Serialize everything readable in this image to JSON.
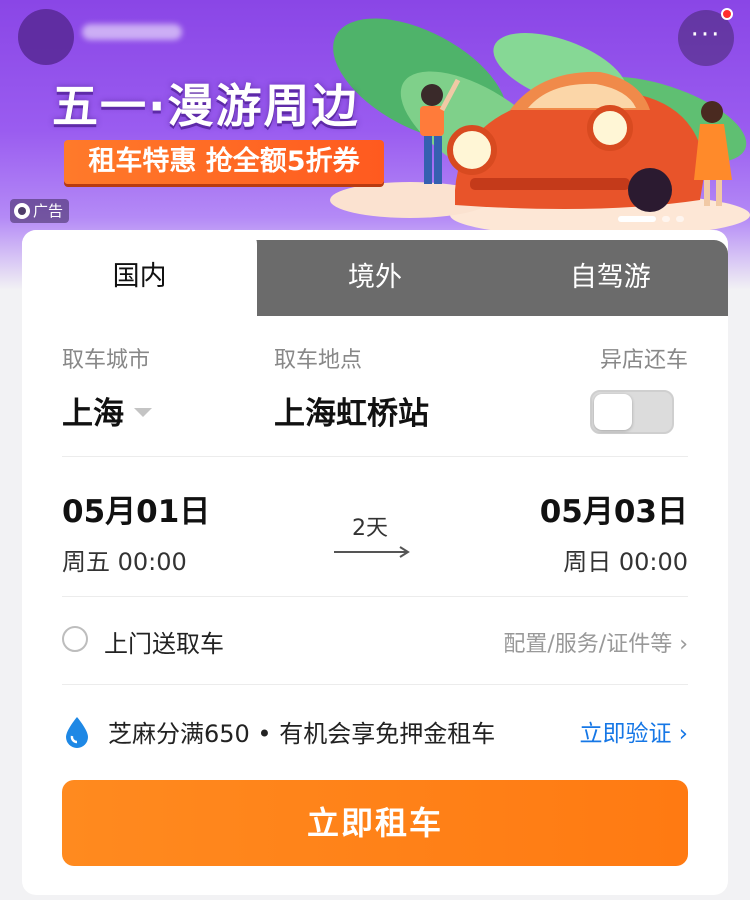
{
  "banner": {
    "title": "五一·漫游周边",
    "promo": "租车特惠 抢全额5折券",
    "ad_label": "广告",
    "more_glyph": "···"
  },
  "tabs": [
    {
      "label": "国内",
      "active": true
    },
    {
      "label": "境外",
      "active": false
    },
    {
      "label": "自驾游",
      "active": false
    }
  ],
  "pickup": {
    "city_label": "取车城市",
    "city_value": "上海",
    "location_label": "取车地点",
    "location_value": "上海虹桥站",
    "diff_store_label": "异店还车",
    "diff_store_on": false
  },
  "dates": {
    "start_date": "05月01日",
    "start_week_time": "周五  00:00",
    "duration": "2天",
    "end_date": "05月03日",
    "end_week_time": "周日  00:00"
  },
  "options": {
    "door_service": "上门送取车",
    "config_link": "配置/服务/证件等 ›"
  },
  "credit": {
    "text": "芝麻分满650 • 有机会享免押金租车",
    "verify_link": "立即验证 ›"
  },
  "cta": {
    "label": "立即租车"
  },
  "colors": {
    "accent": "#ff7a12",
    "link": "#1677e6",
    "banner": "#8a46e6"
  }
}
